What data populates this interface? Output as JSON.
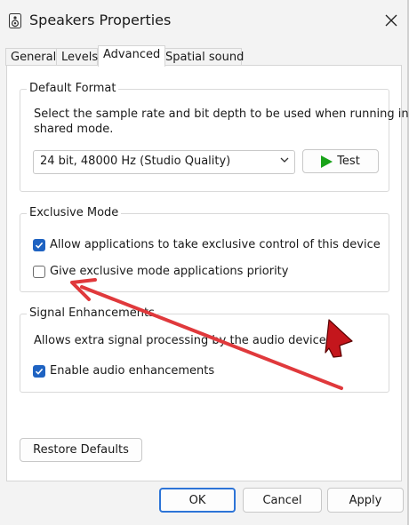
{
  "window": {
    "title": "Speakers Properties"
  },
  "tabs": [
    {
      "label": "General"
    },
    {
      "label": "Levels"
    },
    {
      "label": "Advanced"
    },
    {
      "label": "Spatial sound"
    }
  ],
  "active_tab": "Advanced",
  "default_format": {
    "title": "Default Format",
    "description_line1": "Select the sample rate and bit depth to be used when running in",
    "description_line2": "shared mode.",
    "selected": "24 bit, 48000 Hz (Studio Quality)",
    "test_label": "Test"
  },
  "exclusive_mode": {
    "title": "Exclusive Mode",
    "allow_control_label": "Allow applications to take exclusive control of this device",
    "allow_control_checked": true,
    "priority_label": "Give exclusive mode applications priority",
    "priority_checked": false
  },
  "signal_enhancements": {
    "title": "Signal Enhancements",
    "description": "Allows extra signal processing by the audio device",
    "enable_label": "Enable audio enhancements",
    "enable_checked": true
  },
  "buttons": {
    "restore_defaults": "Restore Defaults",
    "ok": "OK",
    "cancel": "Cancel",
    "apply": "Apply"
  },
  "colors": {
    "accent": "#1f63c2",
    "annotation_arrow": "#e0393c",
    "cursor": "#c4161c",
    "test_play": "#1aa31a"
  },
  "icons": [
    "speaker-app-icon",
    "close-icon",
    "chevron-down-icon",
    "play-icon",
    "checkmark-icon",
    "annotation-arrow",
    "mouse-cursor-icon"
  ]
}
